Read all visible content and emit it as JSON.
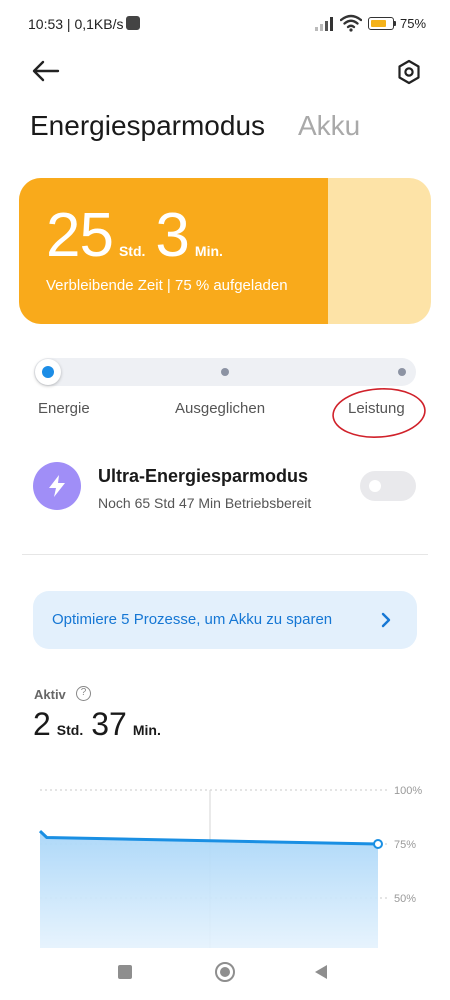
{
  "status_bar": {
    "time_speed": "10:53 | 0,1KB/s",
    "battery_pct": "75",
    "battery_level": 0.75,
    "icons": [
      "notification-square-icon",
      "signal-icon",
      "wifi-icon",
      "battery-icon"
    ]
  },
  "header": {
    "back_icon": "arrow-left-icon",
    "settings_icon": "settings-hexagon-icon"
  },
  "tabs": {
    "active": "Energiesparmodus",
    "inactive": "Akku"
  },
  "time_card": {
    "hours": "25",
    "hours_unit": "Std.",
    "minutes": "3",
    "minutes_unit": "Min.",
    "subtitle": "Verbleibende Zeit | 75 % aufgeladen",
    "charge_level": 0.75,
    "colors": {
      "fill": "#f9aa1b",
      "empty": "#fde3a7"
    }
  },
  "mode_selector": {
    "selected_index": 0,
    "labels": [
      "Energie",
      "Ausgeglichen",
      "Leistung"
    ],
    "accent": "#1c8de6",
    "annotation_color": "#d0212a"
  },
  "ultra_mode": {
    "title": "Ultra-Energiesparmodus",
    "subtitle": "Noch 65 Std 47 Min Betriebsbereit",
    "enabled": false,
    "icon": "lightning-bolt-icon",
    "icon_bg": "#a08ef7"
  },
  "optimize_banner": {
    "text": "Optimiere 5 Prozesse, um Akku zu sparen",
    "icon": "chevron-right-icon"
  },
  "active": {
    "label": "Aktiv",
    "hours": "2",
    "hours_unit": "Std.",
    "minutes": "37",
    "minutes_unit": "Min."
  },
  "chart_data": {
    "type": "area",
    "y_tick_labels": [
      "100%",
      "75%",
      "50%"
    ],
    "ylim": [
      40,
      100
    ],
    "x": [
      0,
      0.02,
      1
    ],
    "values": [
      81,
      78,
      75
    ],
    "line_color": "#1a8fe3",
    "grid": true
  },
  "nav_bar": {
    "icons": [
      "recents-square-icon",
      "home-circle-icon",
      "back-triangle-icon"
    ]
  }
}
